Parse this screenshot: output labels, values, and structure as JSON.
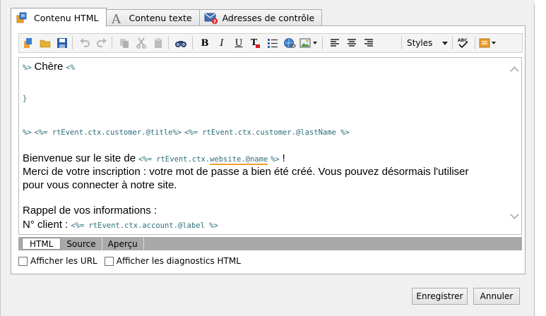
{
  "tabs": [
    {
      "label": "Contenu HTML",
      "icon": "html-content-icon",
      "active": true
    },
    {
      "label": "Contenu texte",
      "icon": "text-content-icon",
      "active": false
    },
    {
      "label": "Adresses de contrôle",
      "icon": "proof-address-icon",
      "active": false
    }
  ],
  "toolbar": {
    "styles_label": "Styles",
    "bold": "B",
    "italic": "I",
    "underline": "U"
  },
  "editor": {
    "l1_tag_a": "%>",
    "l1_text": "Chère",
    "l1_tag_b": "<%",
    "l2": "}",
    "l3_tag_a": "%>",
    "l3_tag_b": "<%= rtEvent.ctx.customer.@title%>",
    "l3_tag_c": "<%= rtEvent.ctx.customer.@lastName %>",
    "l4_text": "Bienvenue sur le site de",
    "l4_tag_pre": "<%= rtEvent.ctx.",
    "l4_tag_err": "website.@name",
    "l4_tag_post": "%>",
    "l4_end": "!",
    "l5": "Merci de votre inscription : votre mot de passe a bien été créé. Vous pouvez désormais l'utiliser",
    "l6": "pour vous connecter à notre site.",
    "l7": "Rappel de vos informations :",
    "l8_text": "N° client :",
    "l8_tag": "<%= rtEvent.ctx.account.@label %>"
  },
  "bottom_tabs": [
    {
      "label": "HTML",
      "active": true
    },
    {
      "label": "Source",
      "active": false
    },
    {
      "label": "Aperçu",
      "active": false
    }
  ],
  "checks": {
    "show_urls": "Afficher les URL",
    "show_diagnostics": "Afficher les diagnostics HTML"
  },
  "buttons": {
    "save": "Enregistrer",
    "cancel": "Annuler"
  },
  "colors": {
    "tag_color": "#2c6e7a",
    "error_underline": "#f0a030"
  }
}
